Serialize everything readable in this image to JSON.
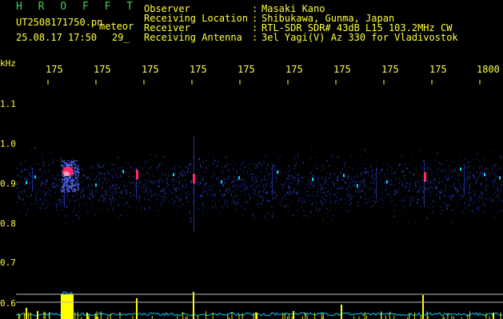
{
  "header": {
    "app_name": "H R O F F T",
    "file_name": "UT2508171750.pn",
    "event_type": "meteor",
    "datetime": "25.08.17 17:50",
    "count": "29_",
    "info": [
      {
        "label": "Observer",
        "sep": ":",
        "value": "Masaki Kano"
      },
      {
        "label": "Receiving Location",
        "sep": ":",
        "value": "Shibukawa, Gunma, Japan"
      },
      {
        "label": "Receiver",
        "sep": ":",
        "value": "RTL-SDR SDR# 43dB L15 103.2MHz CW"
      },
      {
        "label": "Receiving Antenna",
        "sep": ":",
        "value": "3el Yagi(V) Az 330 for Vladivostok"
      }
    ]
  },
  "axes": {
    "y_unit": "kHz",
    "y_ticks": [
      "1.1",
      "1.0",
      "0.9",
      "0.8",
      "0.7",
      "0.6"
    ],
    "x_ticks": [
      "175",
      "175",
      "175",
      "175",
      "175",
      "175",
      "175",
      "175",
      "175",
      "1800"
    ]
  },
  "colors": {
    "text": "#ffff3c",
    "title": "#3fd24a",
    "background": "#000000",
    "noise": "#1c2a8a",
    "echo": "#ff2a6a",
    "level": "#ffff00",
    "baseline": "#00c8ff"
  }
}
